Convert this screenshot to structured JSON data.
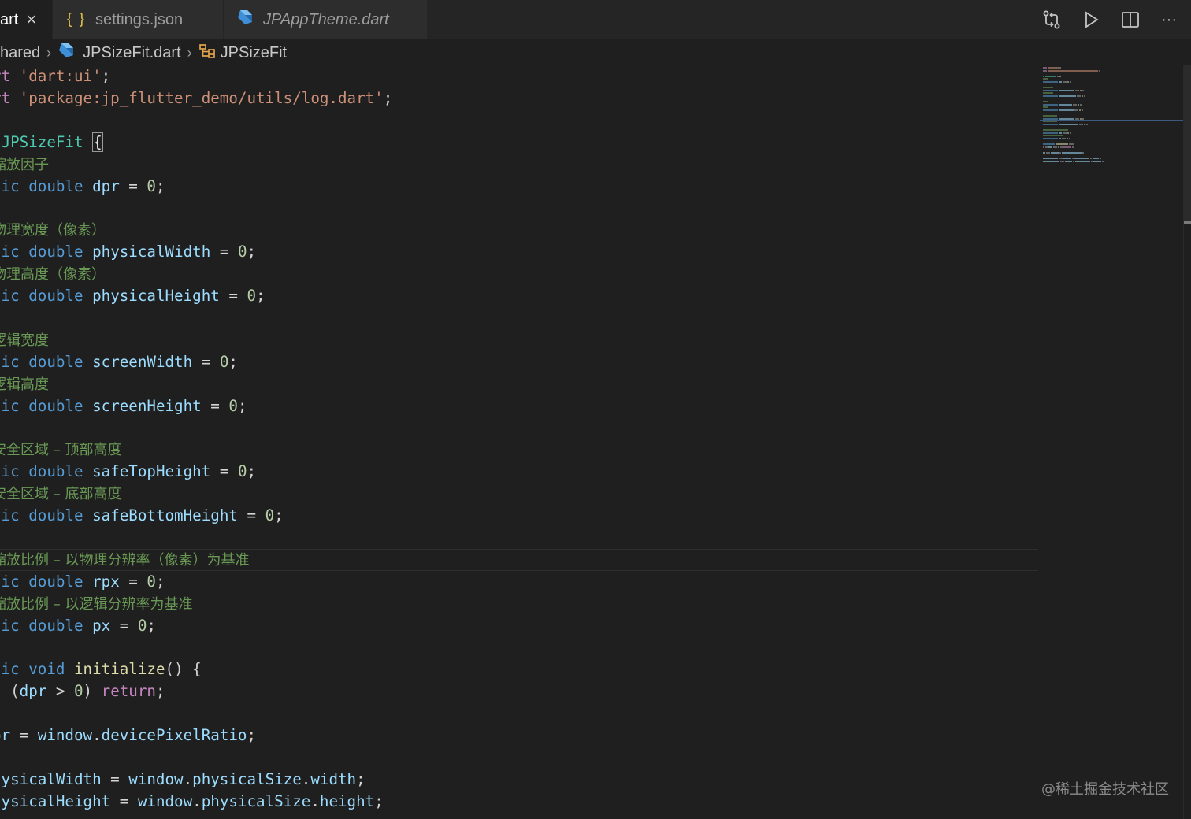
{
  "tabs": [
    {
      "label": "art",
      "active": true
    },
    {
      "label": "settings.json",
      "icon": "json-braces-icon"
    },
    {
      "label": "JPAppTheme.dart",
      "icon": "dart-icon",
      "italic": true
    }
  ],
  "tab_json_icon_text": "{ }",
  "tab_close_glyph": "×",
  "actions": [
    "git-compare-icon",
    "run-icon",
    "split-editor-icon",
    "more-actions-icon"
  ],
  "more_glyph": "···",
  "breadcrumb": {
    "folder": "hared",
    "file": "JPSizeFit.dart",
    "symbol": "JPSizeFit"
  },
  "code_lines": [
    [
      {
        "t": "rt ",
        "c": "kw2"
      },
      {
        "t": "'dart:ui'",
        "c": "str"
      },
      {
        "t": ";",
        "c": "plain"
      }
    ],
    [
      {
        "t": "rt ",
        "c": "kw2"
      },
      {
        "t": "'package:jp_flutter_demo/utils/log.dart'",
        "c": "str"
      },
      {
        "t": ";",
        "c": "plain"
      }
    ],
    [],
    [
      {
        "t": " ",
        "c": "plain"
      },
      {
        "t": "JPSizeFit",
        "c": "cls"
      },
      {
        "t": " ",
        "c": "plain"
      },
      {
        "t": "{",
        "c": "brace"
      }
    ],
    [
      {
        "t": "缩放因子",
        "c": "cmt"
      }
    ],
    [
      {
        "t": "tic ",
        "c": "kw"
      },
      {
        "t": "double ",
        "c": "kw"
      },
      {
        "t": "dpr",
        "c": "var"
      },
      {
        "t": " = ",
        "c": "plain"
      },
      {
        "t": "0",
        "c": "num"
      },
      {
        "t": ";",
        "c": "plain"
      }
    ],
    [],
    [
      {
        "t": "物理宽度（像素）",
        "c": "cmt"
      }
    ],
    [
      {
        "t": "tic ",
        "c": "kw"
      },
      {
        "t": "double ",
        "c": "kw"
      },
      {
        "t": "physicalWidth",
        "c": "var"
      },
      {
        "t": " = ",
        "c": "plain"
      },
      {
        "t": "0",
        "c": "num"
      },
      {
        "t": ";",
        "c": "plain"
      }
    ],
    [
      {
        "t": "物理高度（像素）",
        "c": "cmt"
      }
    ],
    [
      {
        "t": "tic ",
        "c": "kw"
      },
      {
        "t": "double ",
        "c": "kw"
      },
      {
        "t": "physicalHeight",
        "c": "var"
      },
      {
        "t": " = ",
        "c": "plain"
      },
      {
        "t": "0",
        "c": "num"
      },
      {
        "t": ";",
        "c": "plain"
      }
    ],
    [],
    [
      {
        "t": "逻辑宽度",
        "c": "cmt"
      }
    ],
    [
      {
        "t": "tic ",
        "c": "kw"
      },
      {
        "t": "double ",
        "c": "kw"
      },
      {
        "t": "screenWidth",
        "c": "var"
      },
      {
        "t": " = ",
        "c": "plain"
      },
      {
        "t": "0",
        "c": "num"
      },
      {
        "t": ";",
        "c": "plain"
      }
    ],
    [
      {
        "t": "逻辑高度",
        "c": "cmt"
      }
    ],
    [
      {
        "t": "tic ",
        "c": "kw"
      },
      {
        "t": "double ",
        "c": "kw"
      },
      {
        "t": "screenHeight",
        "c": "var"
      },
      {
        "t": " = ",
        "c": "plain"
      },
      {
        "t": "0",
        "c": "num"
      },
      {
        "t": ";",
        "c": "plain"
      }
    ],
    [],
    [
      {
        "t": "安全区域 – 顶部高度",
        "c": "cmt"
      }
    ],
    [
      {
        "t": "tic ",
        "c": "kw"
      },
      {
        "t": "double ",
        "c": "kw"
      },
      {
        "t": "safeTopHeight",
        "c": "var"
      },
      {
        "t": " = ",
        "c": "plain"
      },
      {
        "t": "0",
        "c": "num"
      },
      {
        "t": ";",
        "c": "plain"
      }
    ],
    [
      {
        "t": "安全区域 – 底部高度",
        "c": "cmt"
      }
    ],
    [
      {
        "t": "tic ",
        "c": "kw"
      },
      {
        "t": "double ",
        "c": "kw"
      },
      {
        "t": "safeBottomHeight",
        "c": "var"
      },
      {
        "t": " = ",
        "c": "plain"
      },
      {
        "t": "0",
        "c": "num"
      },
      {
        "t": ";",
        "c": "plain"
      }
    ],
    [],
    [
      {
        "t": "缩放比例 – 以物理分辨率（像素）为基准",
        "c": "cmt"
      }
    ],
    [
      {
        "t": "tic ",
        "c": "kw"
      },
      {
        "t": "double ",
        "c": "kw"
      },
      {
        "t": "rpx",
        "c": "var"
      },
      {
        "t": " = ",
        "c": "plain"
      },
      {
        "t": "0",
        "c": "num"
      },
      {
        "t": ";",
        "c": "plain"
      }
    ],
    [
      {
        "t": "缩放比例 – 以逻辑分辨率为基准",
        "c": "cmt"
      }
    ],
    [
      {
        "t": "tic ",
        "c": "kw"
      },
      {
        "t": "double ",
        "c": "kw"
      },
      {
        "t": "px",
        "c": "var"
      },
      {
        "t": " = ",
        "c": "plain"
      },
      {
        "t": "0",
        "c": "num"
      },
      {
        "t": ";",
        "c": "plain"
      }
    ],
    [],
    [
      {
        "t": "tic ",
        "c": "kw"
      },
      {
        "t": "void ",
        "c": "kw"
      },
      {
        "t": "initialize",
        "c": "fn"
      },
      {
        "t": "() {",
        "c": "plain"
      }
    ],
    [
      {
        "t": "f",
        "c": "kw2"
      },
      {
        "t": " (",
        "c": "plain"
      },
      {
        "t": "dpr",
        "c": "var"
      },
      {
        "t": " > ",
        "c": "plain"
      },
      {
        "t": "0",
        "c": "num"
      },
      {
        "t": ") ",
        "c": "plain"
      },
      {
        "t": "return",
        "c": "kw2"
      },
      {
        "t": ";",
        "c": "plain"
      }
    ],
    [],
    [
      {
        "t": "pr",
        "c": "var"
      },
      {
        "t": " = ",
        "c": "plain"
      },
      {
        "t": "window",
        "c": "var"
      },
      {
        "t": ".",
        "c": "plain"
      },
      {
        "t": "devicePixelRatio",
        "c": "var"
      },
      {
        "t": ";",
        "c": "plain"
      }
    ],
    [],
    [
      {
        "t": "hysicalWidth",
        "c": "var"
      },
      {
        "t": " = ",
        "c": "plain"
      },
      {
        "t": "window",
        "c": "var"
      },
      {
        "t": ".",
        "c": "plain"
      },
      {
        "t": "physicalSize",
        "c": "var"
      },
      {
        "t": ".",
        "c": "plain"
      },
      {
        "t": "width",
        "c": "var"
      },
      {
        "t": ";",
        "c": "plain"
      }
    ],
    [
      {
        "t": "hysicalHeight",
        "c": "var"
      },
      {
        "t": " = ",
        "c": "plain"
      },
      {
        "t": "window",
        "c": "var"
      },
      {
        "t": ".",
        "c": "plain"
      },
      {
        "t": "physicalSize",
        "c": "var"
      },
      {
        "t": ".",
        "c": "plain"
      },
      {
        "t": "height",
        "c": "var"
      },
      {
        "t": ";",
        "c": "plain"
      }
    ]
  ],
  "colors": {
    "keyword": "#569cd6",
    "control": "#c586c0",
    "string": "#ce9178",
    "class": "#4ec9b0",
    "variable": "#9cdcfe",
    "number": "#b5cea8",
    "function": "#dcdcaa",
    "comment": "#6a9955",
    "background": "#1f1f1f"
  },
  "watermark": "@稀土掘金技术社区"
}
